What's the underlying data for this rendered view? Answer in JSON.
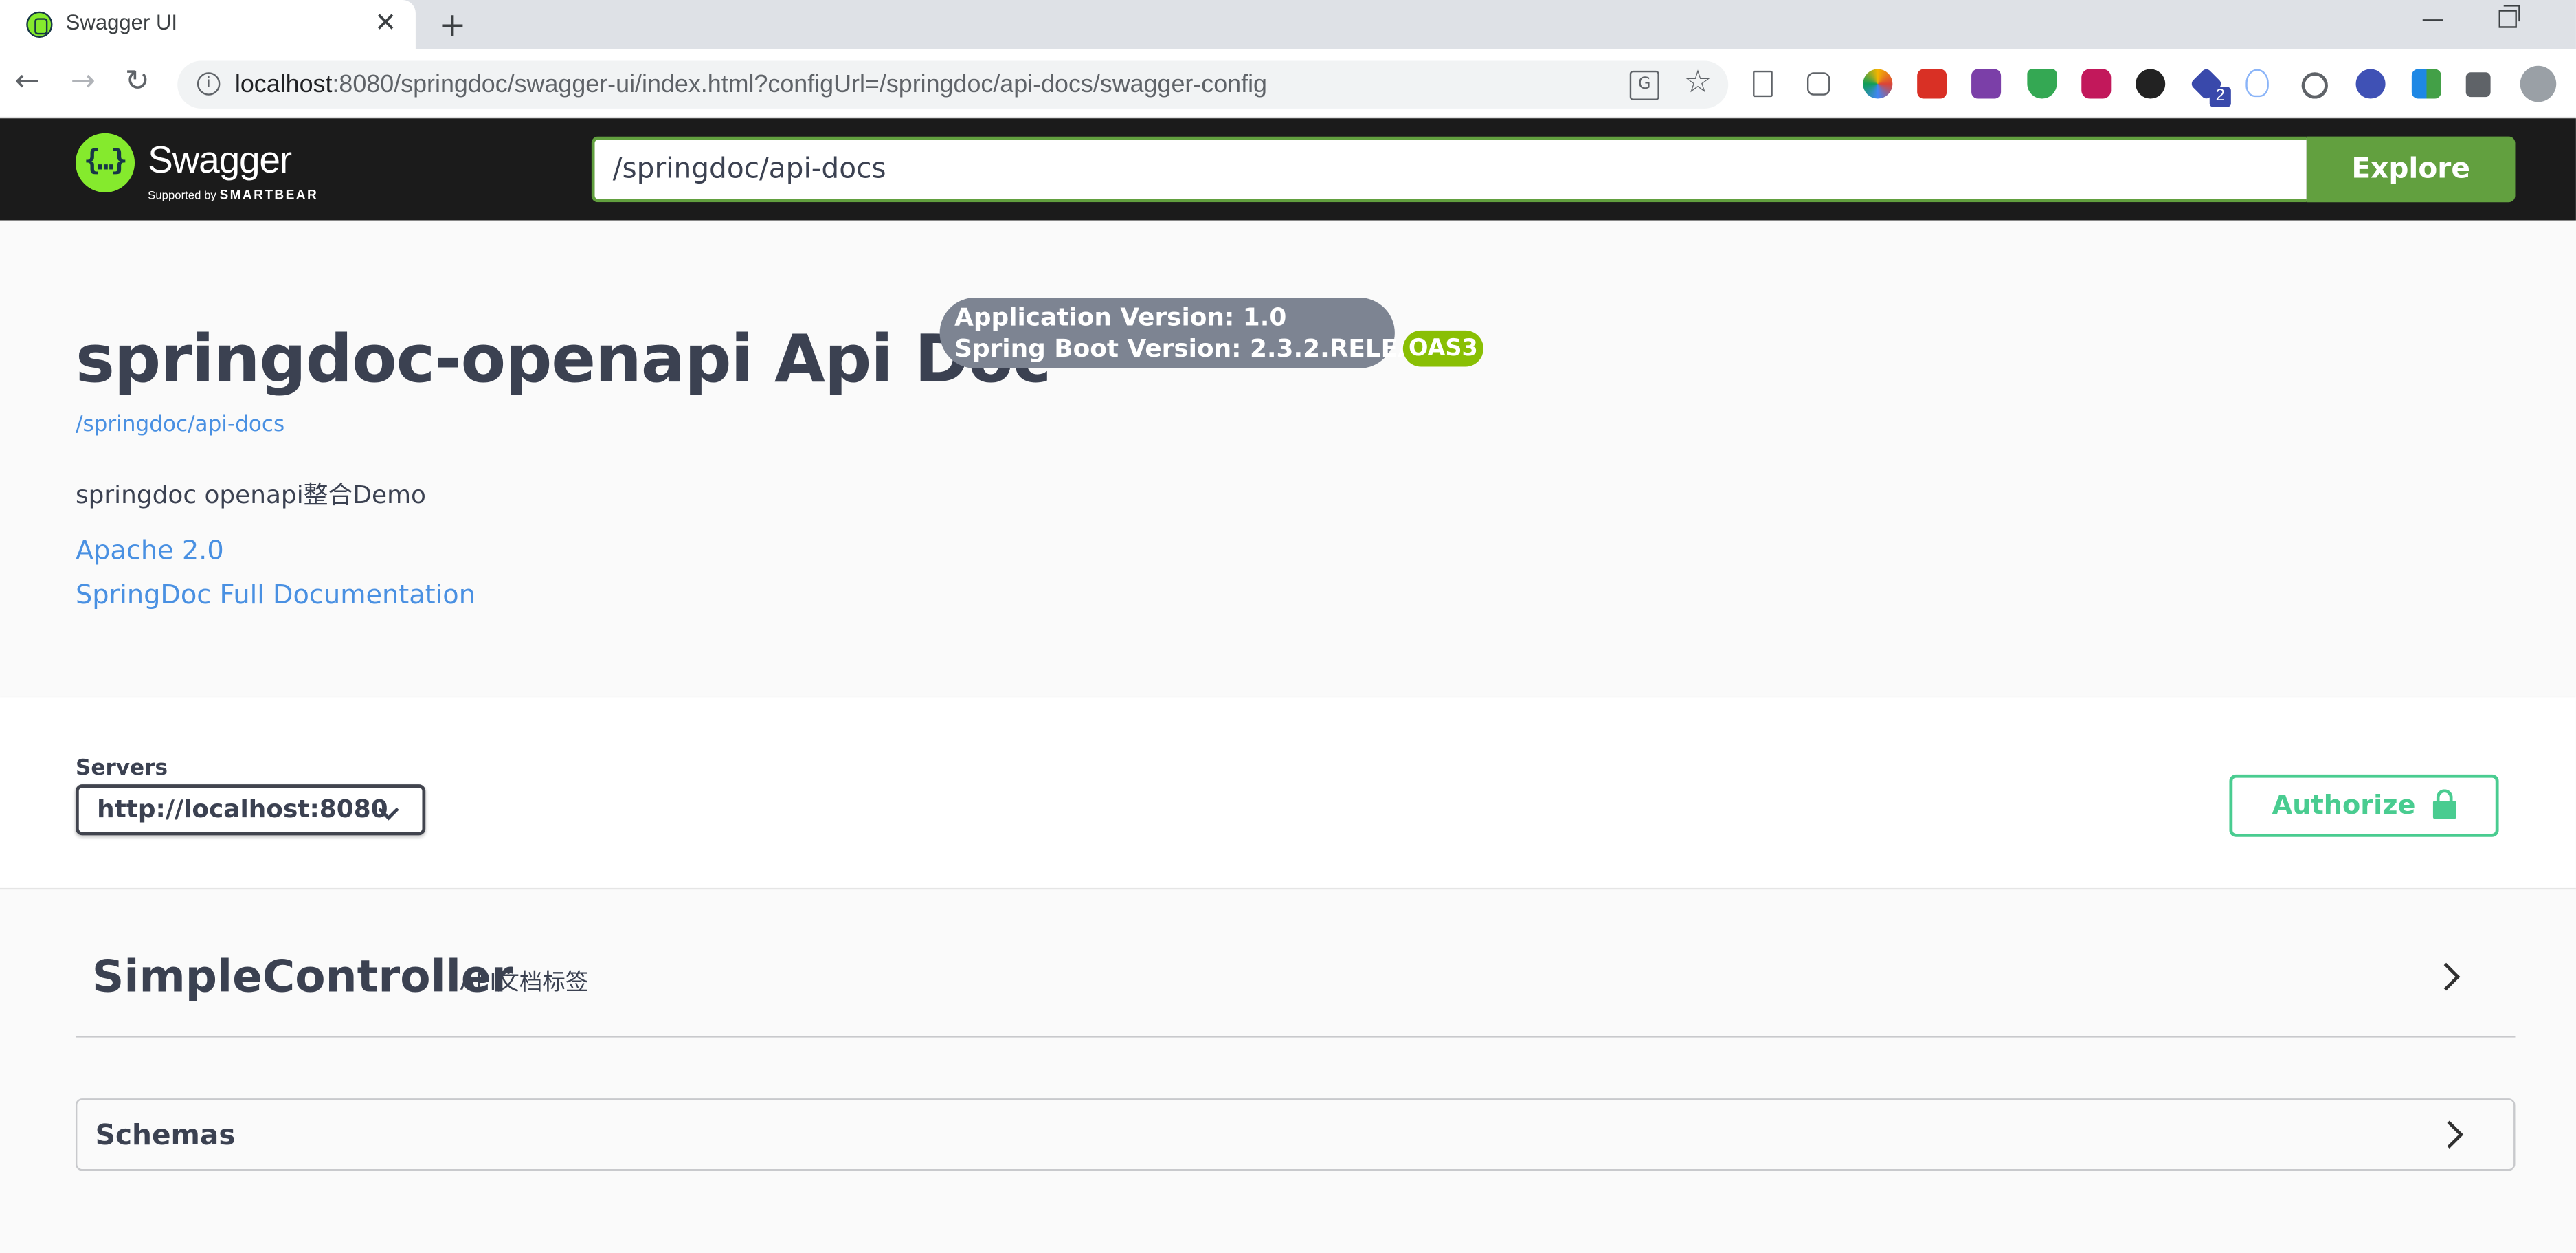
{
  "browser": {
    "tab_title": "Swagger UI",
    "close_glyph": "✕",
    "newtab_glyph": "+",
    "minimize_glyph": "—",
    "url_host": "localhost",
    "url_rest": ":8080/springdoc/swagger-ui/index.html?configUrl=/springdoc/api-docs/swagger-config",
    "back_glyph": "←",
    "forward_glyph": "→",
    "reload_glyph": "↻",
    "info_glyph": "i",
    "translate_glyph": "G",
    "star_glyph": "☆",
    "extension_badge": "2",
    "extension_icons": [
      "bookmark-icon",
      "copy-icon",
      "palette-icon",
      "fe-helper-icon",
      "onenote-icon",
      "shield-icon",
      "camera-icon",
      "slack-icon",
      "cube-icon",
      "hand-icon",
      "speed-icon",
      "avatar-icon",
      "grid-icon",
      "puzzle-icon",
      "profile-icon"
    ]
  },
  "topbar": {
    "logo_glyph": "{…}",
    "logo_text": "Swagger",
    "logo_sub_prefix": "Supported by",
    "logo_sub_brand": "SMARTBEAR",
    "spec_url": "/springdoc/api-docs",
    "explore_label": "Explore"
  },
  "info": {
    "title": "springdoc-openapi Api Doc",
    "version_line1": "Application Version: 1.0",
    "version_line2": "Spring Boot Version: 2.3.2.RELEASE",
    "oas_badge": "OAS3",
    "spec_link": "/springdoc/api-docs",
    "description": "springdoc openapi整合Demo",
    "license_link": "Apache 2.0",
    "docs_link": "SpringDoc Full Documentation"
  },
  "servers": {
    "label": "Servers",
    "selected": "http://localhost:8080",
    "authorize_label": "Authorize"
  },
  "operations": {
    "tag_name": "SimpleController",
    "tag_description": "API文档标签",
    "schemas_label": "Schemas"
  },
  "colors": {
    "swagger_green": "#85ea2d",
    "explore_green": "#62a03f",
    "authorize_green": "#49cc90",
    "oas_green": "#89bf04",
    "link_blue": "#4990e2",
    "topbar_dark": "#1b1b1b"
  }
}
